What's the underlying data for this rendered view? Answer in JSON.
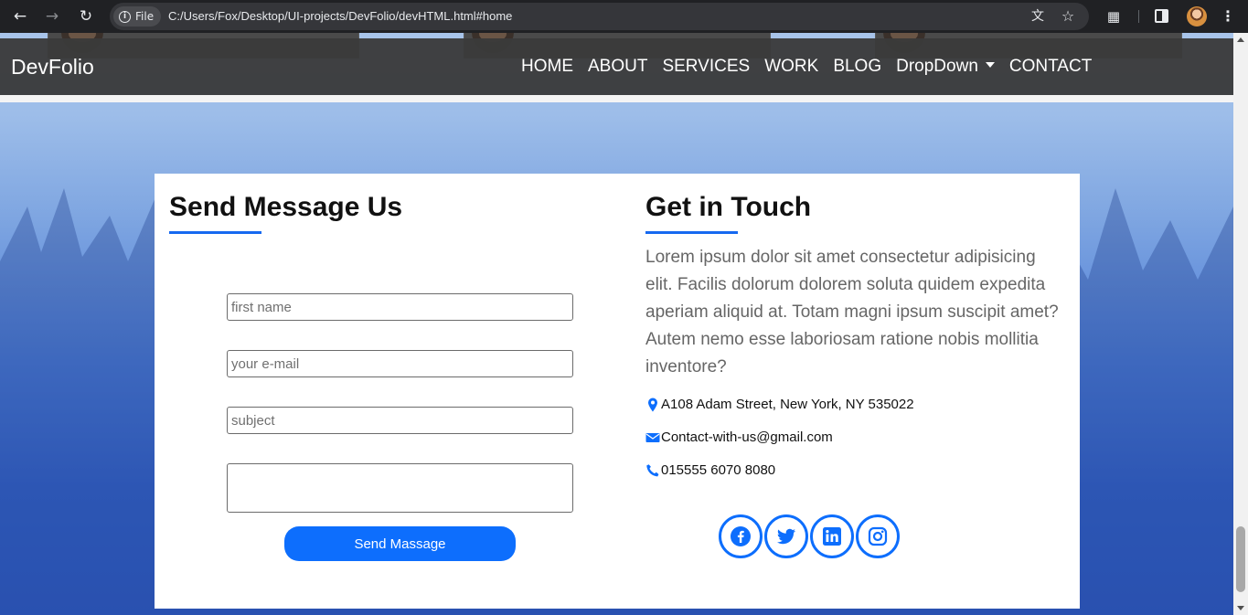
{
  "browser": {
    "file_chip": "File",
    "url": "C:/Users/Fox/Desktop/UI-projects/DevFolio/devHTML.html#home",
    "icons": [
      "back-arrow-icon",
      "forward-arrow-icon",
      "reload-icon",
      "info-icon",
      "translate-icon",
      "star-icon",
      "extensions-icon",
      "side-panel-icon",
      "profile-avatar",
      "kebab-menu-icon"
    ]
  },
  "navbar": {
    "brand": "DevFolio",
    "links": [
      "HOME",
      "ABOUT",
      "SERVICES",
      "WORK",
      "BLOG",
      "DropDown",
      "CONTACT"
    ]
  },
  "contact": {
    "form_heading": "Send Message Us",
    "touch_heading": "Get in Touch",
    "placeholders": {
      "first_name": "first name",
      "email": "your e-mail",
      "subject": "subject"
    },
    "send_label": "Send Massage",
    "lorem": "Lorem ipsum dolor sit amet consectetur adipisicing elit. Facilis dolorum dolorem soluta quidem expedita aperiam aliquid at. Totam magni ipsum suscipit amet? Autem nemo esse laboriosam ratione nobis mollitia inventore?",
    "address": "A108 Adam Street, New York, NY 535022",
    "email": "Contact-with-us@gmail.com",
    "phone": "015555 6070 8080",
    "socials": [
      "facebook-icon",
      "twitter-icon",
      "linkedin-icon",
      "instagram-icon"
    ]
  },
  "colors": {
    "accent": "#0d6efd",
    "navbar": "#3a3a3a",
    "chrome": "#202124"
  }
}
